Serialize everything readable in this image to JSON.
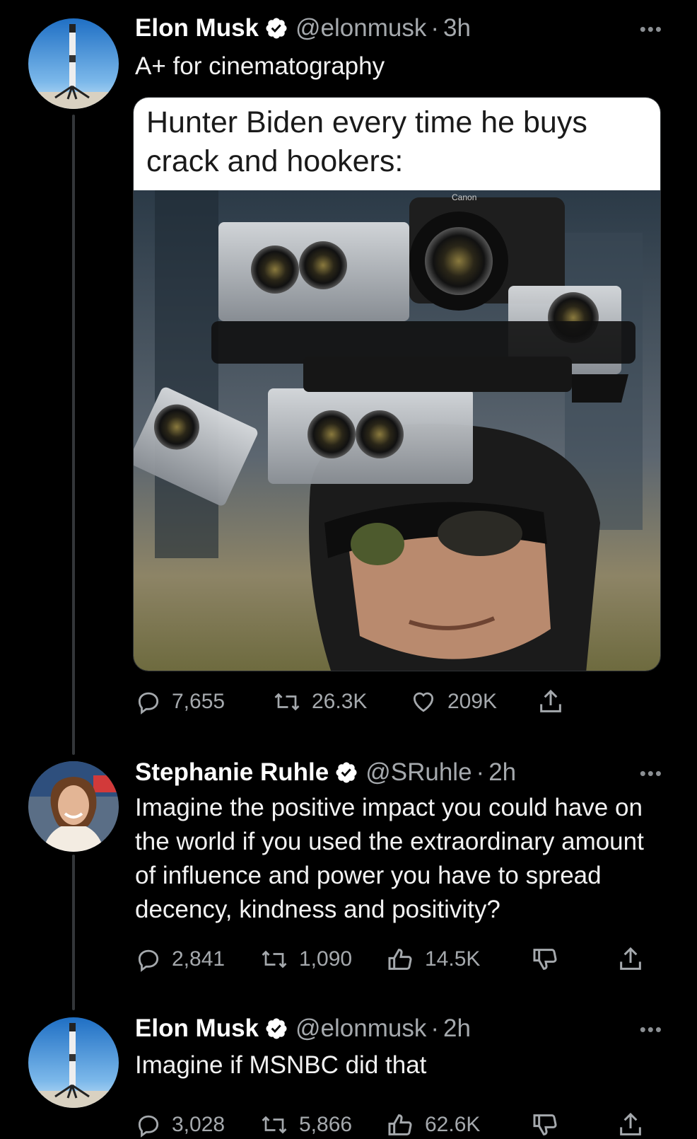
{
  "tweets": [
    {
      "name": "Elon Musk",
      "handle": "@elonmusk",
      "sep": "·",
      "time": "3h",
      "text": "A+ for cinematography",
      "media_caption": "Hunter Biden every time he buys crack and hookers:",
      "camera_brand": "Canon",
      "replies": "7,655",
      "retweets": "26.3K",
      "likes": "209K"
    },
    {
      "name": "Stephanie Ruhle",
      "handle": "@SRuhle",
      "sep": "·",
      "time": "2h",
      "text": "Imagine the positive impact you could have on the world if you used the extraordinary amount of influence and power you have to spread decency, kindness and positivity?",
      "replies": "2,841",
      "retweets": "1,090",
      "likes": "14.5K"
    },
    {
      "name": "Elon Musk",
      "handle": "@elonmusk",
      "sep": "·",
      "time": "2h",
      "text": "Imagine if MSNBC did that",
      "replies": "3,028",
      "retweets": "5,866",
      "likes": "62.6K"
    }
  ],
  "icons": [
    "verified-badge-icon",
    "more-icon",
    "reply-icon",
    "retweet-icon",
    "like-heart-icon",
    "like-thumb-icon",
    "dislike-icon",
    "share-icon"
  ],
  "colors": {
    "background": "#000000",
    "text": "#e7e9ea",
    "muted": "#a5a9ad",
    "badge": "#ffffff"
  }
}
